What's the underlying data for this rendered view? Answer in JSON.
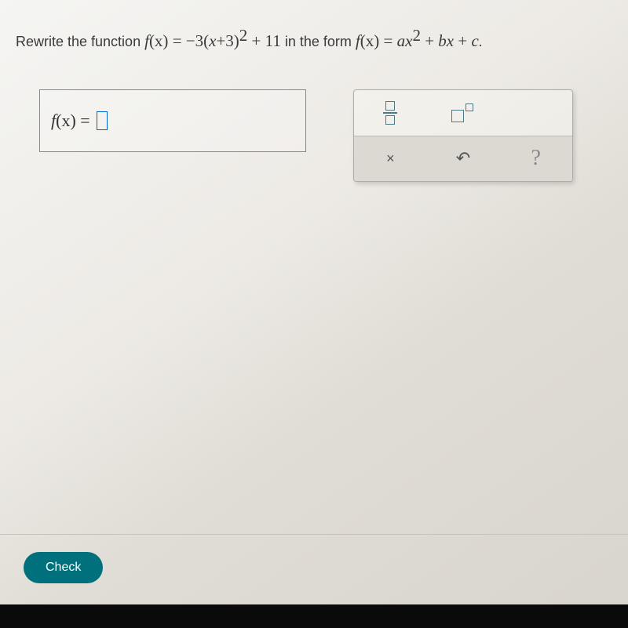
{
  "prompt": {
    "prefix": "Rewrite the function ",
    "eq1_fx": "f",
    "eq1_paren_x": "(x)",
    "eq1_equals": " = ",
    "eq1_expr_neg": "−3(",
    "eq1_x": "x",
    "eq1_plus3": "+3)",
    "eq1_sup": "2",
    "eq1_plus11": " + 11",
    "middle": " in the form ",
    "eq2_fx": "f",
    "eq2_paren_x": "(x)",
    "eq2_equals": " = ",
    "eq2_a": "a",
    "eq2_x": "x",
    "eq2_sup": "2",
    "eq2_plus": " + ",
    "eq2_b": "b",
    "eq2_x2": "x",
    "eq2_plus2": " + ",
    "eq2_c": "c",
    "eq2_period": "."
  },
  "answer": {
    "label_f": "f",
    "label_paren": "(x)",
    "label_eq": " = ",
    "value": ""
  },
  "tools": {
    "fraction": "fraction",
    "exponent": "exponent",
    "clear": "×",
    "undo": "↶",
    "help": "?"
  },
  "footer": {
    "check_label": "Check"
  }
}
